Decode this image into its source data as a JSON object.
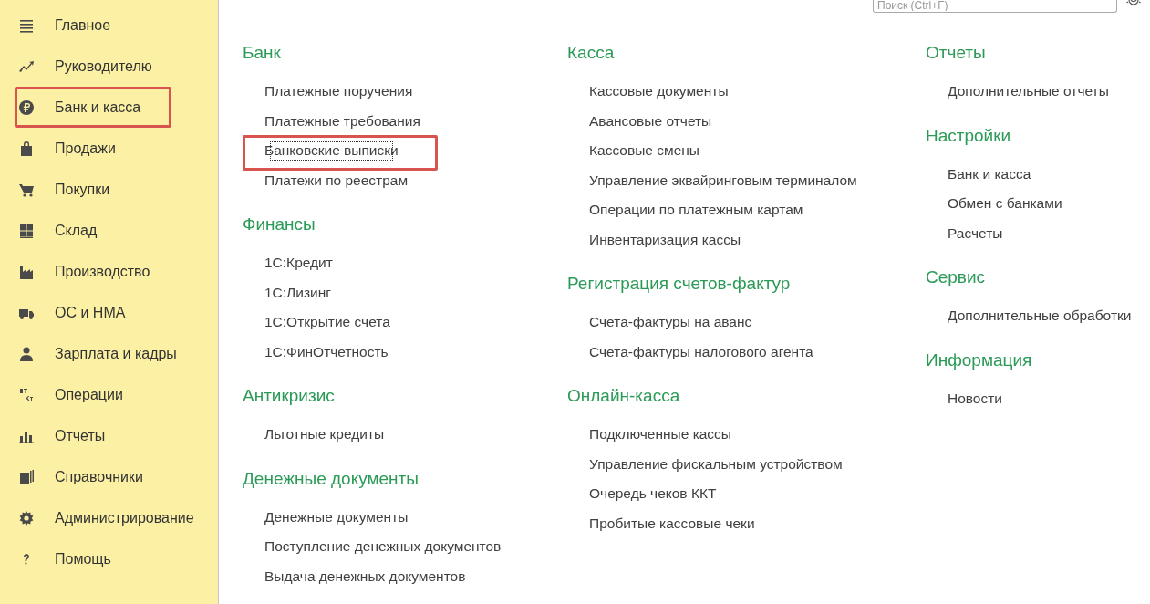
{
  "search": {
    "placeholder": "Поиск (Ctrl+F)"
  },
  "sidebar": {
    "items": [
      {
        "label": "Главное",
        "highlighted": false
      },
      {
        "label": "Руководителю",
        "highlighted": false
      },
      {
        "label": "Банк и касса",
        "highlighted": true
      },
      {
        "label": "Продажи",
        "highlighted": false
      },
      {
        "label": "Покупки",
        "highlighted": false
      },
      {
        "label": "Склад",
        "highlighted": false
      },
      {
        "label": "Производство",
        "highlighted": false
      },
      {
        "label": "ОС и НМА",
        "highlighted": false
      },
      {
        "label": "Зарплата и кадры",
        "highlighted": false
      },
      {
        "label": "Операции",
        "highlighted": false
      },
      {
        "label": "Отчеты",
        "highlighted": false
      },
      {
        "label": "Справочники",
        "highlighted": false
      },
      {
        "label": "Администрирование",
        "highlighted": false
      },
      {
        "label": "Помощь",
        "highlighted": false
      }
    ]
  },
  "columns": [
    {
      "sections": [
        {
          "title": "Банк",
          "links": [
            {
              "label": "Платежные поручения",
              "highlighted": false
            },
            {
              "label": "Платежные требования",
              "highlighted": false
            },
            {
              "label": "Банковские выписки",
              "highlighted": true
            },
            {
              "label": "Платежи по реестрам",
              "highlighted": false
            }
          ]
        },
        {
          "title": "Финансы",
          "links": [
            {
              "label": "1С:Кредит",
              "highlighted": false
            },
            {
              "label": "1С:Лизинг",
              "highlighted": false
            },
            {
              "label": "1С:Открытие счета",
              "highlighted": false
            },
            {
              "label": "1С:ФинОтчетность",
              "highlighted": false
            }
          ]
        },
        {
          "title": "Антикризис",
          "links": [
            {
              "label": "Льготные кредиты",
              "highlighted": false
            }
          ]
        },
        {
          "title": "Денежные документы",
          "links": [
            {
              "label": "Денежные документы",
              "highlighted": false
            },
            {
              "label": "Поступление денежных документов",
              "highlighted": false
            },
            {
              "label": "Выдача денежных документов",
              "highlighted": false
            }
          ]
        }
      ]
    },
    {
      "sections": [
        {
          "title": "Касса",
          "links": [
            {
              "label": "Кассовые документы",
              "highlighted": false
            },
            {
              "label": "Авансовые отчеты",
              "highlighted": false
            },
            {
              "label": "Кассовые смены",
              "highlighted": false
            },
            {
              "label": "Управление эквайринговым терминалом",
              "highlighted": false
            },
            {
              "label": "Операции по платежным картам",
              "highlighted": false
            },
            {
              "label": "Инвентаризация кассы",
              "highlighted": false
            }
          ]
        },
        {
          "title": "Регистрация счетов-фактур",
          "links": [
            {
              "label": "Счета-фактуры на аванс",
              "highlighted": false
            },
            {
              "label": "Счета-фактуры налогового агента",
              "highlighted": false
            }
          ]
        },
        {
          "title": "Онлайн-касса",
          "links": [
            {
              "label": "Подключенные кассы",
              "highlighted": false
            },
            {
              "label": "Управление фискальным устройством",
              "highlighted": false
            },
            {
              "label": "Очередь чеков ККТ",
              "highlighted": false
            },
            {
              "label": "Пробитые кассовые чеки",
              "highlighted": false
            }
          ]
        }
      ]
    },
    {
      "sections": [
        {
          "title": "Отчеты",
          "links": [
            {
              "label": "Дополнительные отчеты",
              "highlighted": false
            }
          ]
        },
        {
          "title": "Настройки",
          "links": [
            {
              "label": "Банк и касса",
              "highlighted": false
            },
            {
              "label": "Обмен с банками",
              "highlighted": false
            },
            {
              "label": "Расчеты",
              "highlighted": false
            }
          ]
        },
        {
          "title": "Сервис",
          "links": [
            {
              "label": "Дополнительные обработки",
              "highlighted": false
            }
          ]
        },
        {
          "title": "Информация",
          "links": [
            {
              "label": "Новости",
              "highlighted": false
            }
          ]
        }
      ]
    }
  ]
}
